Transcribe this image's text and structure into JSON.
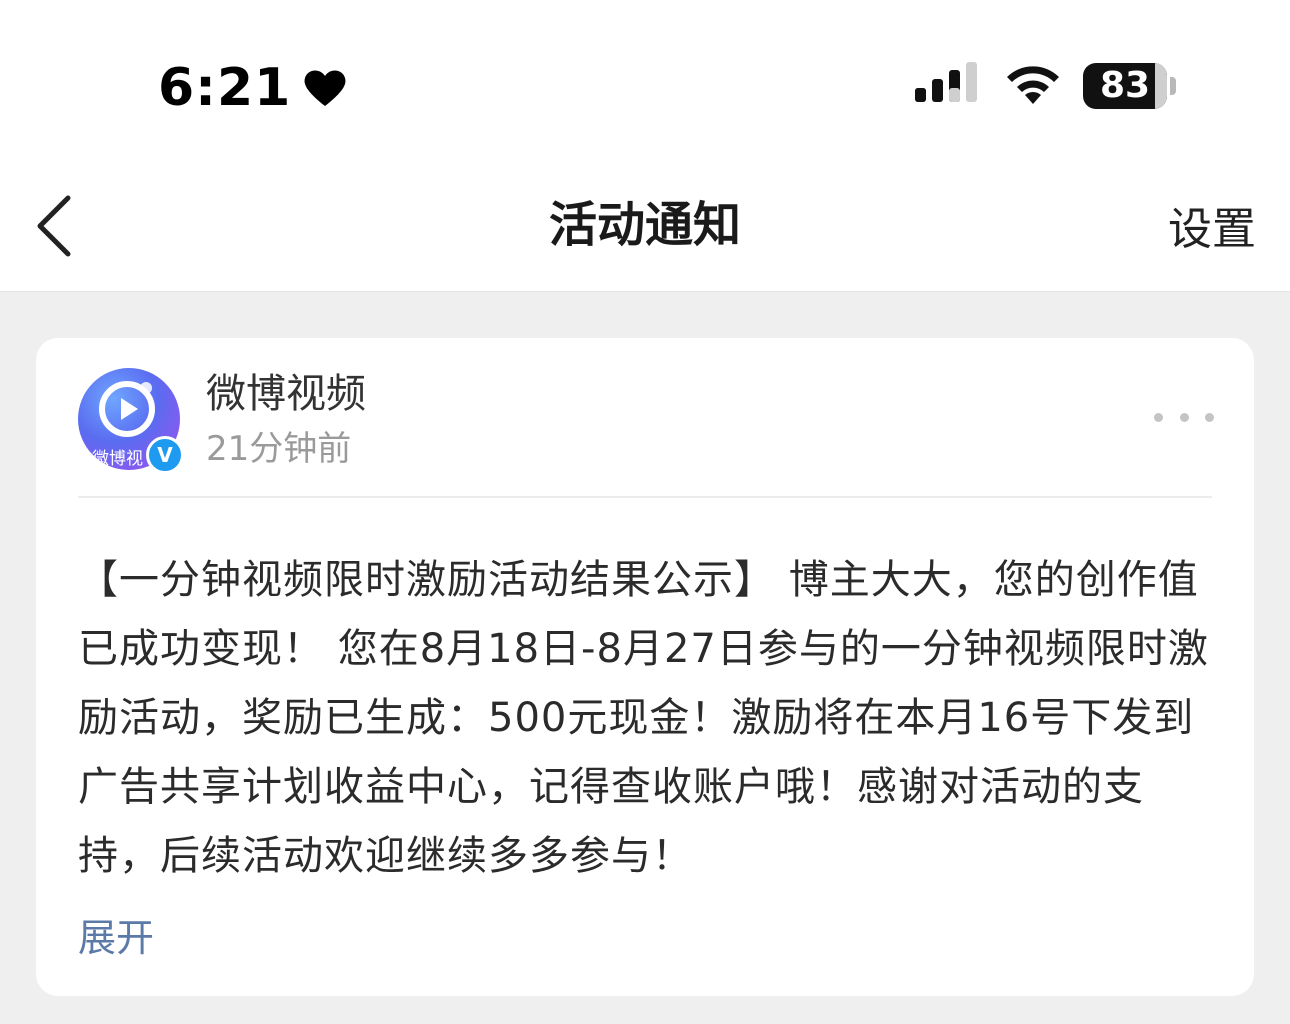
{
  "status_bar": {
    "time": "6:21",
    "battery": "83"
  },
  "nav": {
    "title": "活动通知",
    "settings_label": "设置"
  },
  "post": {
    "account_name": "微博视频",
    "avatar_text": "微博视",
    "verified_mark": "V",
    "time_ago": "21分钟前",
    "content": "【一分钟视频限时激励活动结果公示】 博主大大，您的创作值已成功变现！ 您在8月18日-8月27日参与的一分钟视频限时激励活动，奖励已生成：500元现金！激励将在本月16号下发到广告共享计划收益中心，记得查收账户哦！感谢对活动的支持，后续活动欢迎继续多多参与！",
    "expand_label": "展开"
  },
  "icons": {
    "back": "chevron-left-icon",
    "more": "more-dots-icon",
    "heart": "heart-icon",
    "signal": "cellular-signal-icon",
    "wifi": "wifi-icon"
  },
  "colors": {
    "page_background": "#efefef",
    "card_background": "#ffffff",
    "link": "#5c7aa8",
    "verified": "#1e9bf0"
  }
}
